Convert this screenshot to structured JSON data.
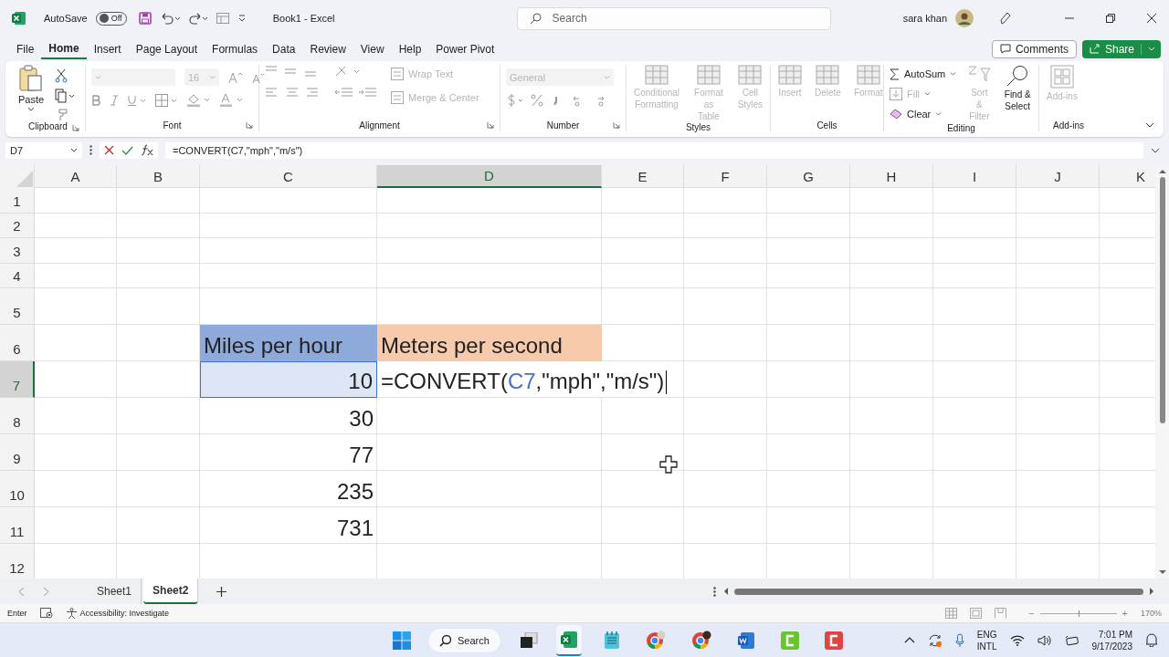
{
  "title_bar": {
    "autosave": {
      "label": "AutoSave",
      "on": false,
      "state": "Off"
    },
    "title": "Book1  -  Excel",
    "search": {
      "placeholder": "Search"
    },
    "user": "sara khan"
  },
  "menu_tabs": [
    {
      "label": "File",
      "selected": false
    },
    {
      "label": "Home",
      "selected": true
    },
    {
      "label": "Insert",
      "selected": false
    },
    {
      "label": "Page Layout",
      "selected": false
    },
    {
      "label": "Formulas",
      "selected": false
    },
    {
      "label": "Data",
      "selected": false
    },
    {
      "label": "Review",
      "selected": false
    },
    {
      "label": "View",
      "selected": false
    },
    {
      "label": "Help",
      "selected": false
    },
    {
      "label": "Power Pivot",
      "selected": false
    }
  ],
  "comments_button": "Comments",
  "share_button": "Share",
  "ribbon": {
    "clipboard": {
      "label": "Clipboard",
      "paste": "Paste"
    },
    "font": {
      "label": "Font",
      "size": "16"
    },
    "alignment": {
      "label": "Alignment",
      "buttons": [
        {
          "label": "Wrap Text",
          "disabled": true
        },
        {
          "label": "Merge & Center",
          "disabled": true
        }
      ]
    },
    "number": {
      "label": "Number",
      "format": "General"
    },
    "styles": {
      "label": "Styles",
      "buttons": [
        {
          "label": "Conditional Formatting",
          "disabled": true
        },
        {
          "label": "Format as Table",
          "disabled": true
        },
        {
          "label": "Cell Styles",
          "disabled": true
        }
      ]
    },
    "cells": {
      "label": "Cells",
      "buttons": [
        {
          "label": "Insert",
          "disabled": true
        },
        {
          "label": "Delete",
          "disabled": true
        },
        {
          "label": "Format",
          "disabled": true
        }
      ]
    },
    "editing": {
      "label": "Editing",
      "buttons": [
        {
          "label": "AutoSum",
          "kind": "small",
          "disabled": false
        },
        {
          "label": "Fill",
          "kind": "small",
          "disabled": true
        },
        {
          "label": "Clear",
          "kind": "small",
          "disabled": false
        },
        {
          "label": "Sort & Filter",
          "kind": "large",
          "disabled": true
        },
        {
          "label": "Find & Select",
          "kind": "large",
          "disabled": false
        }
      ]
    },
    "addins": {
      "label": "Add-ins",
      "buttons": [
        {
          "label": "Add-ins",
          "disabled": true
        }
      ]
    }
  },
  "formula_bar": {
    "name_box": "D7",
    "formula": "=CONVERT(C7,\"mph\",\"m/s\")"
  },
  "columns": [
    {
      "label": "A",
      "selected": false
    },
    {
      "label": "B",
      "selected": false
    },
    {
      "label": "C",
      "selected": false
    },
    {
      "label": "D",
      "selected": true
    },
    {
      "label": "E",
      "selected": false
    },
    {
      "label": "F",
      "selected": false
    },
    {
      "label": "G",
      "selected": false
    },
    {
      "label": "H",
      "selected": false
    },
    {
      "label": "I",
      "selected": false
    },
    {
      "label": "J",
      "selected": false
    },
    {
      "label": "K",
      "selected": false
    }
  ],
  "rows": [
    {
      "label": "1",
      "selected": false
    },
    {
      "label": "2",
      "selected": false
    },
    {
      "label": "3",
      "selected": false
    },
    {
      "label": "4",
      "selected": false
    },
    {
      "label": "5",
      "selected": false
    },
    {
      "label": "6",
      "selected": false,
      "C": {
        "text": "Miles per hour",
        "color": "#8eaadb"
      },
      "D": {
        "text": "Meters per second",
        "color": "#f7caac"
      }
    },
    {
      "label": "7",
      "selected": true,
      "C": {
        "text": "10",
        "referenced": true
      },
      "D": {
        "editing": true,
        "parts": [
          {
            "text": "=CONVERT(",
            "kind": "plain"
          },
          {
            "text": "C7",
            "kind": "reference"
          },
          {
            "text": ",\"mph\",\"m/s\")",
            "kind": "plain"
          }
        ]
      }
    },
    {
      "label": "8",
      "selected": false,
      "C": {
        "text": "30"
      }
    },
    {
      "label": "9",
      "selected": false,
      "C": {
        "text": "77"
      }
    },
    {
      "label": "10",
      "selected": false,
      "C": {
        "text": "235"
      }
    },
    {
      "label": "11",
      "selected": false,
      "C": {
        "text": "731"
      }
    },
    {
      "label": "12",
      "selected": false
    }
  ],
  "sheet_tabs": [
    {
      "label": "Sheet1",
      "selected": false
    },
    {
      "label": "Sheet2",
      "selected": true
    }
  ],
  "status_bar": {
    "mode": "Enter",
    "accessibility": "Accessibility: Investigate",
    "zoom_out": "−",
    "zoom_in": "+",
    "zoom_slider": {
      "level": 0.5
    },
    "zoom": "170%"
  },
  "taskbar": {
    "search": "Search",
    "language": "ENG",
    "layout": "INTL",
    "time": "7:01 PM",
    "date": "9/17/2023"
  }
}
